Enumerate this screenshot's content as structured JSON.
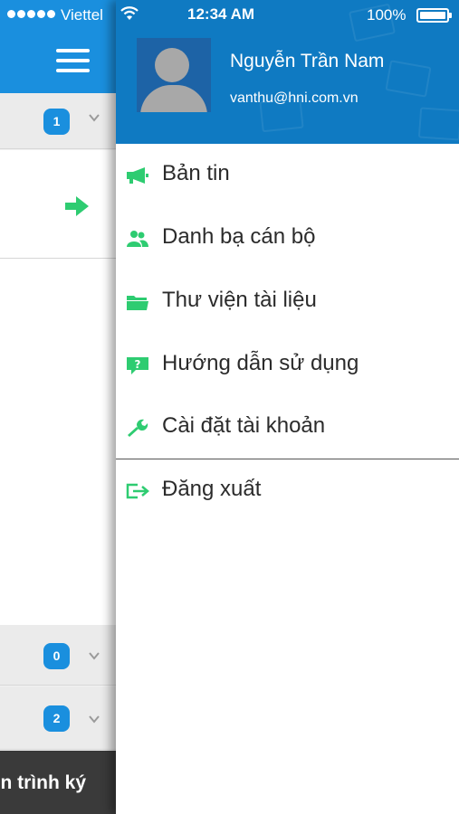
{
  "status_bar": {
    "carrier": "Viettel",
    "time": "12:34 AM",
    "battery": "100%"
  },
  "background_screen": {
    "sections": [
      {
        "badge": "1"
      },
      {
        "badge": "0"
      },
      {
        "badge": "2"
      }
    ],
    "bottom_button_label": "n trình ký"
  },
  "drawer": {
    "user": {
      "name": "Nguyễn Trần Nam",
      "email": "vanthu@hni.com.vn"
    },
    "menu": [
      {
        "label": "Bản tin",
        "icon": "megaphone-icon"
      },
      {
        "label": "Danh bạ cán bộ",
        "icon": "users-icon"
      },
      {
        "label": "Thư viện tài liệu",
        "icon": "folder-icon"
      },
      {
        "label": "Hướng dẫn sử dụng",
        "icon": "help-icon"
      },
      {
        "label": "Cài đặt tài khoản",
        "icon": "wrench-icon"
      }
    ],
    "logout_label": "Đăng xuất"
  },
  "colors": {
    "primary_blue": "#1a8fde",
    "header_blue": "#0f7ac2",
    "accent_green": "#2ecc71",
    "bottom_bar": "#3a3a3a"
  }
}
